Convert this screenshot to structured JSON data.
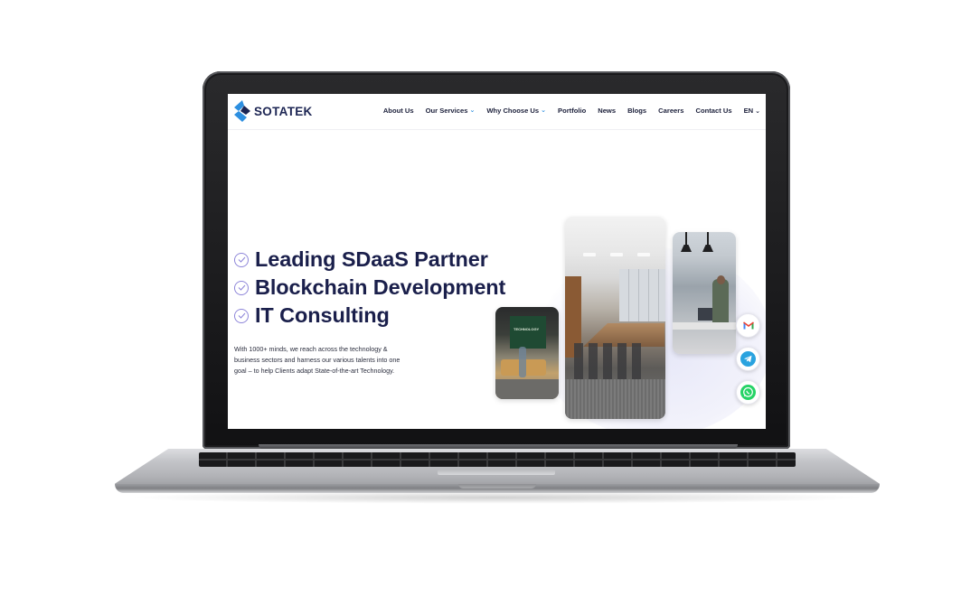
{
  "site": {
    "logo_text": "SOTATEK",
    "nav": {
      "about": "About Us",
      "services": "Our Services",
      "why": "Why Choose Us",
      "portfolio": "Portfolio",
      "news": "News",
      "blogs": "Blogs",
      "careers": "Careers",
      "contact": "Contact Us",
      "language": "EN"
    },
    "hero": {
      "headline_1": "Leading SDaaS Partner",
      "headline_2": "Blockchain Development",
      "headline_3": "IT Consulting",
      "intro": "With 1000+ minds, we reach across the technology & business sectors and harness our various talents into one goal – to help Clients adapt State-of-the-art Technology."
    },
    "photo_sign": "TECHNOLOGY",
    "contact_buttons": [
      "gmail-icon",
      "telegram-icon",
      "whatsapp-icon"
    ],
    "colors": {
      "brand_navy": "#1a1f4b",
      "brand_blue": "#2d8fe0",
      "check_purple": "#8e86d9"
    }
  }
}
